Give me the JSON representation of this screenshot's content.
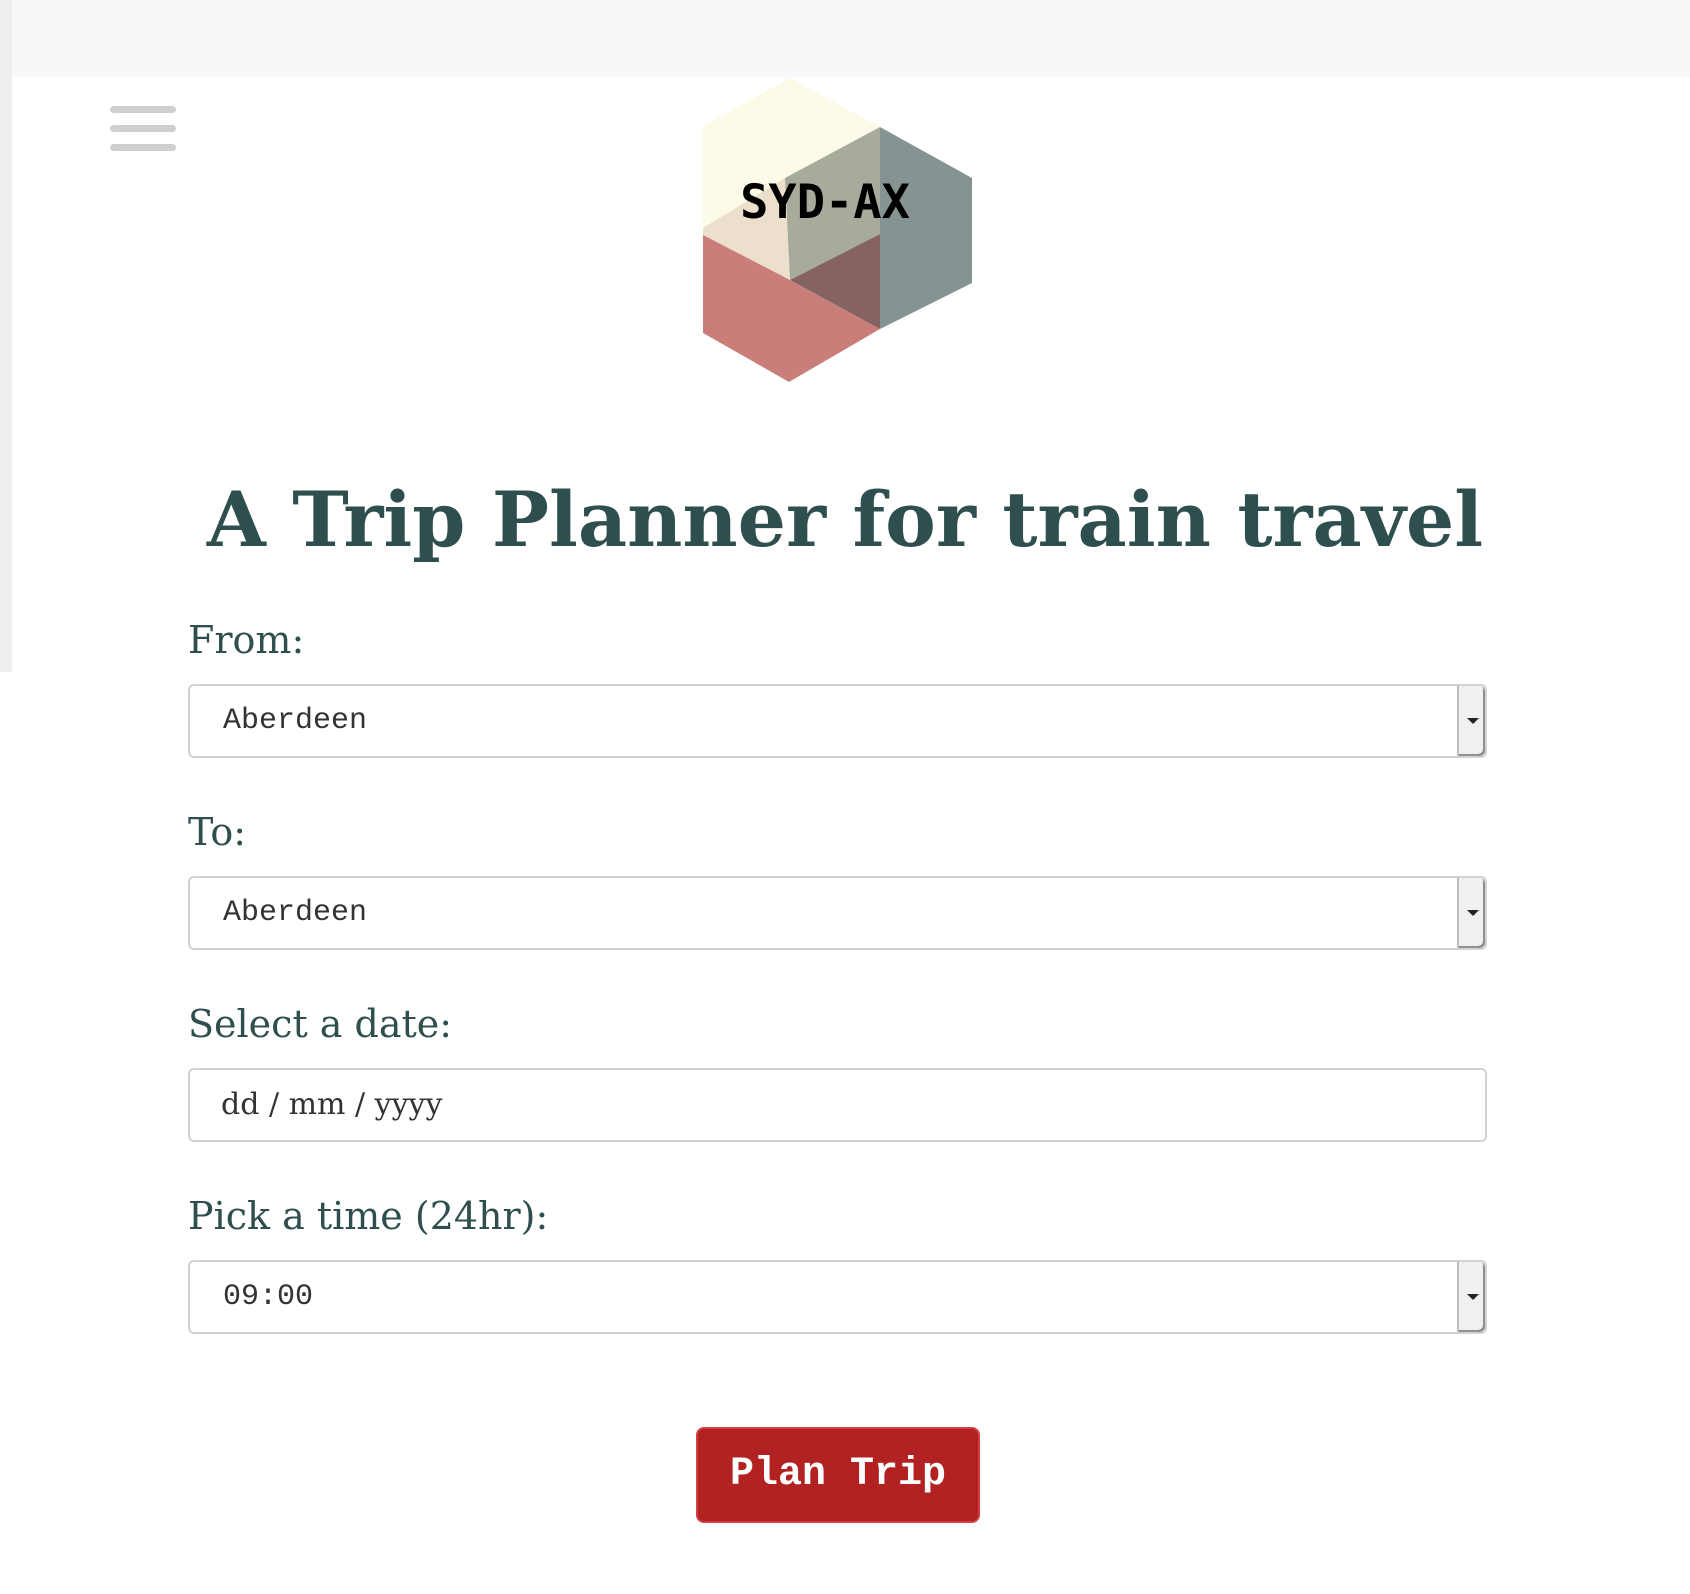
{
  "header": {
    "menu_icon": "hamburger-menu-icon"
  },
  "logo": {
    "text": "SYD-AX",
    "colors": {
      "cream": "#fdfbe8",
      "tan": "#ece0cc",
      "gray_green": "#a7ab9b",
      "slate": "#869393",
      "rose": "#c97e7a",
      "mauve": "#856363"
    }
  },
  "main": {
    "title": "A Trip Planner for train travel",
    "from": {
      "label": "From:",
      "value": "Aberdeen"
    },
    "to": {
      "label": "To:",
      "value": "Aberdeen"
    },
    "date": {
      "label": "Select a date:",
      "placeholder": "dd / mm / yyyy"
    },
    "time": {
      "label": "Pick a time (24hr):",
      "value": "09:00"
    },
    "submit_label": "Plan Trip"
  },
  "colors": {
    "title_text": "#2f4f4f",
    "button_bg": "#b22222",
    "button_text": "#ffffff"
  }
}
